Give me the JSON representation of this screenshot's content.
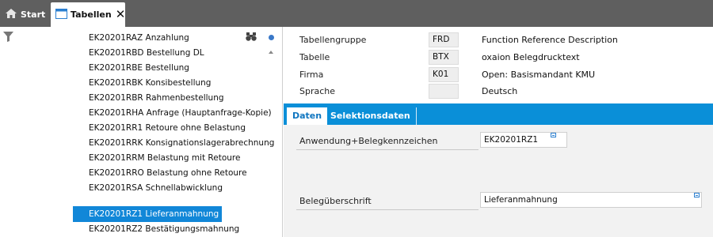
{
  "tabs": {
    "start_label": "Start",
    "tabellen_label": "Tabellen",
    "close_glyph": "✕",
    "icons": {
      "start": "home-icon",
      "tabellen": "window-icon",
      "close": "close-icon"
    }
  },
  "left_panel": {
    "toolbar": {
      "filter_icon": "filter-icon",
      "search_icon": "binoculars-icon",
      "status_icon": "status-dot-icon"
    },
    "items": [
      {
        "label": "EK20201RAZ Anzahlung",
        "selected": false
      },
      {
        "label": "EK20201RBD Bestellung DL",
        "selected": false
      },
      {
        "label": "EK20201RBE Bestellung",
        "selected": false
      },
      {
        "label": "EK20201RBK Konsibestellung",
        "selected": false
      },
      {
        "label": "EK20201RBR Rahmenbestellung",
        "selected": false
      },
      {
        "label": "EK20201RHA Anfrage (Hauptanfrage-Kopie)",
        "selected": false
      },
      {
        "label": "EK20201RR1 Retoure  ohne Belastung",
        "selected": false
      },
      {
        "label": "EK20201RRK Konsignationslagerabrechnung",
        "selected": false
      },
      {
        "label": "EK20201RRM Belastung mit Retoure",
        "selected": false
      },
      {
        "label": "EK20201RRO Belastung ohne Retoure",
        "selected": false
      },
      {
        "label": "EK20201RSA Schnellabwicklung",
        "selected": false
      },
      {
        "label": "EK20201RZ1 Lieferanmahnung",
        "selected": true
      },
      {
        "label": "EK20201RZ2 Bestätigungsmahnung",
        "selected": false
      }
    ]
  },
  "header_fields": [
    {
      "label": "Tabellengruppe",
      "value": "FRD",
      "description": "Function Reference Description"
    },
    {
      "label": "Tabelle",
      "value": "BTX",
      "description": "oxaion Belegdrucktext"
    },
    {
      "label": "Firma",
      "value": "K01",
      "description": "Open: Basismandant KMU"
    },
    {
      "label": "Sprache",
      "value": "",
      "description": "Deutsch"
    }
  ],
  "detail_tabs": [
    {
      "label": "Daten",
      "active": true
    },
    {
      "label": "Selektionsdaten",
      "active": false
    }
  ],
  "detail_fields": [
    {
      "label": "Anwendung+Belegkennzeichen",
      "value": "EK20201RZ1"
    },
    {
      "label": "Belegüberschrift",
      "value": "Lieferanmahnung"
    }
  ],
  "colors": {
    "topbar": "#5f5f5f",
    "selection": "#1187d8",
    "tabbar": "#0a8fd8",
    "details_bg": "#f2f2f2"
  }
}
